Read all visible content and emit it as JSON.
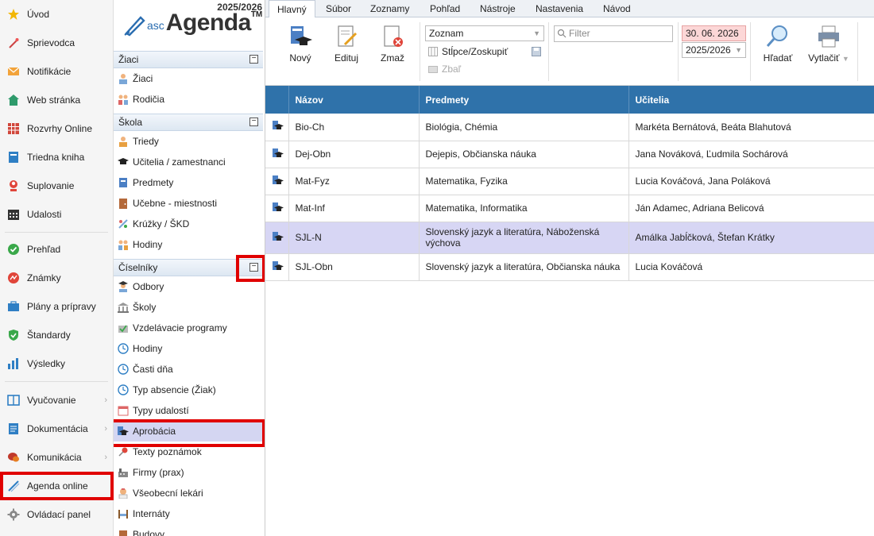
{
  "left_nav": {
    "items": [
      {
        "label": "Úvod",
        "icon": "star-icon"
      },
      {
        "label": "Sprievodca",
        "icon": "wand-icon"
      },
      {
        "label": "Notifikácie",
        "icon": "mail-icon"
      },
      {
        "label": "Web stránka",
        "icon": "home-icon"
      },
      {
        "label": "Rozvrhy Online",
        "icon": "grid-icon"
      },
      {
        "label": "Triedna kniha",
        "icon": "book-icon"
      },
      {
        "label": "Suplovanie",
        "icon": "person-icon"
      },
      {
        "label": "Udalosti",
        "icon": "calendar-icon"
      },
      {
        "label": "Prehľad",
        "icon": "check-icon"
      },
      {
        "label": "Známky",
        "icon": "grade-icon"
      },
      {
        "label": "Plány a prípravy",
        "icon": "briefcase-icon"
      },
      {
        "label": "Štandardy",
        "icon": "shield-icon"
      },
      {
        "label": "Výsledky",
        "icon": "bar-chart-icon"
      },
      {
        "label": "Vyučovanie",
        "icon": "open-book-icon"
      },
      {
        "label": "Dokumentácia",
        "icon": "document-icon"
      },
      {
        "label": "Komunikácia",
        "icon": "chat-icon"
      },
      {
        "label": "Agenda online",
        "icon": "pen-icon"
      },
      {
        "label": "Ovládací panel",
        "icon": "gear-icon"
      }
    ]
  },
  "logo": {
    "year": "2025/2026",
    "asc": "asc",
    "name": "Agenda",
    "tm": "TM"
  },
  "mid_panel": {
    "zIaci": {
      "title": "Žiaci",
      "toggle": "−",
      "items": [
        {
          "label": "Žiaci"
        },
        {
          "label": "Rodičia"
        }
      ]
    },
    "skola": {
      "title": "Škola",
      "toggle": "−",
      "items": [
        {
          "label": "Triedy"
        },
        {
          "label": "Učitelia / zamestnanci"
        },
        {
          "label": "Predmety"
        },
        {
          "label": "Učebne - miestnosti"
        },
        {
          "label": "Krúžky / ŠKD"
        },
        {
          "label": "Hodiny"
        }
      ]
    },
    "ciselniky": {
      "title": "Číselníky",
      "toggle": "−",
      "items": [
        {
          "label": "Odbory"
        },
        {
          "label": "Školy"
        },
        {
          "label": "Vzdelávacie programy"
        },
        {
          "label": "Hodiny"
        },
        {
          "label": "Časti dňa"
        },
        {
          "label": "Typ absencie (Žiak)"
        },
        {
          "label": "Typy udalostí"
        },
        {
          "label": "Aprobácia"
        },
        {
          "label": "Texty poznámok"
        },
        {
          "label": "Firmy (prax)"
        },
        {
          "label": "Všeobecní lekári"
        },
        {
          "label": "Internáty"
        },
        {
          "label": "Budovy"
        }
      ]
    }
  },
  "tabs": [
    "Hlavný",
    "Súbor",
    "Zoznamy",
    "Pohľad",
    "Nástroje",
    "Nastavenia",
    "Návod"
  ],
  "toolbar": {
    "new": "Nový",
    "edit": "Edituj",
    "delete": "Zmaž",
    "view_select": "Zoznam",
    "columns": "Stĺpce/Zoskupiť",
    "collapse": "Zbaľ",
    "filter_placeholder": "Filter",
    "date": "30. 06. 2026",
    "year_select": "2025/2026",
    "find": "Hľadať",
    "print": "Vytlačiť"
  },
  "table": {
    "headers": [
      "Názov",
      "Predmety",
      "Učitelia"
    ],
    "rows": [
      {
        "name": "Bio-Ch",
        "subjects": "Biológia, Chémia",
        "teachers": "Markéta Bernátová, Beáta Blahutová"
      },
      {
        "name": "Dej-Obn",
        "subjects": "Dejepis, Občianska náuka",
        "teachers": "Jana Nováková, Ľudmila Sochárová"
      },
      {
        "name": "Mat-Fyz",
        "subjects": "Matematika, Fyzika",
        "teachers": "Lucia Kováčová, Jana Poláková"
      },
      {
        "name": "Mat-Inf",
        "subjects": "Matematika, Informatika",
        "teachers": "Ján Adamec, Adriana Belicová"
      },
      {
        "name": "SJL-N",
        "subjects": "Slovenský jazyk a literatúra, Náboženská výchova",
        "teachers": "Amálka Jabĺčková, Štefan Krátky"
      },
      {
        "name": "SJL-Obn",
        "subjects": "Slovenský jazyk a literatúra, Občianska náuka",
        "teachers": "Lucia Kováčová"
      }
    ]
  },
  "colors": {
    "header_blue": "#2f72aa",
    "selected_row": "#d7d6f4",
    "highlight_red": "#e00000",
    "date_bg": "#fcd7d7"
  }
}
